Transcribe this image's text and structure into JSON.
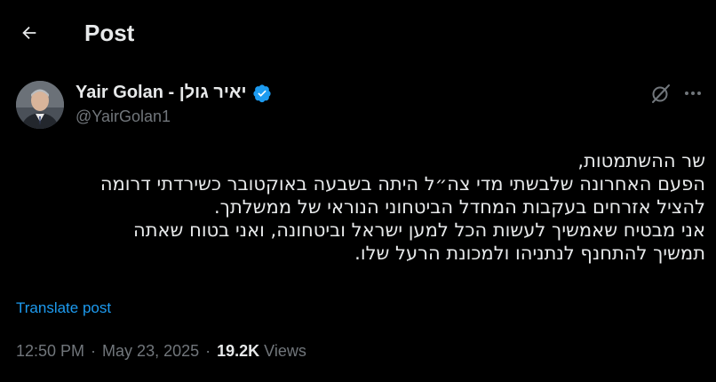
{
  "header": {
    "title": "Post"
  },
  "author": {
    "display_name": "Yair Golan - יאיר גולן",
    "handle": "@YairGolan1",
    "verified_color": "#1d9bf0"
  },
  "post": {
    "lines": [
      "שר ההשתמטות,",
      "הפעם האחרונה שלבשתי מדי צה״ל היתה בשבעה באוקטובר כשירדתי דרומה",
      "להציל אזרחים בעקבות המחדל הביטחוני הנוראי של ממשלתך.",
      "אני מבטיח שאמשיך לעשות הכל למען ישראל וביטחונה, ואני בטוח שאתה",
      "תמשיך להתחנף לנתניהו ולמכונת הרעל שלו."
    ],
    "translate_label": "Translate post"
  },
  "meta": {
    "time": "12:50 PM",
    "date": "May 23, 2025",
    "views_count": "19.2K",
    "views_label": "Views"
  },
  "icons": {
    "back": "arrow-left-icon",
    "verified": "verified-badge-icon",
    "grok": "grok-icon",
    "more": "more-icon"
  }
}
